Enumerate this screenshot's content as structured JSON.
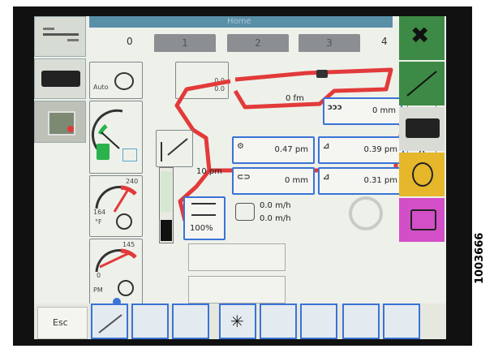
{
  "header": {
    "title": "Home"
  },
  "tabs": [
    {
      "label": "0"
    },
    {
      "label": "1"
    },
    {
      "label": "2"
    },
    {
      "label": "3"
    },
    {
      "label": "4"
    }
  ],
  "fuel": {
    "label": "Auto",
    "eco_icon": "fuel-eco-icon"
  },
  "gauges": {
    "engine_temp": {
      "max": "240",
      "value": "164",
      "unit": "°F"
    },
    "hydraulic_temp": {
      "max": "145",
      "value": "0",
      "unit": "PM"
    }
  },
  "fan": {
    "percent": "100%"
  },
  "header_height": {
    "value": "10 pm"
  },
  "measurements": {
    "top_center": {
      "value": "0 fm"
    },
    "upper_right": {
      "value": "0 mm"
    },
    "reel_left": {
      "value": "0.47 pm"
    },
    "reel_right": {
      "value": "0.39 pm"
    },
    "lower_left": {
      "value": "0 mm"
    },
    "lower_right": {
      "value": "0.31 pm"
    }
  },
  "small_readout": {
    "line1": "0.0",
    "line2": "0.0"
  },
  "speeds": {
    "top": "0.0 m/h",
    "bottom": "0.0 m/h"
  },
  "bottom_bar": {
    "esc_label": "Esc"
  },
  "figure_id": "1003666",
  "colors": {
    "accent": "#3a73d6",
    "warning": "#e23a3a",
    "header": "#5a8fa8",
    "tab": "#8b8f92"
  }
}
